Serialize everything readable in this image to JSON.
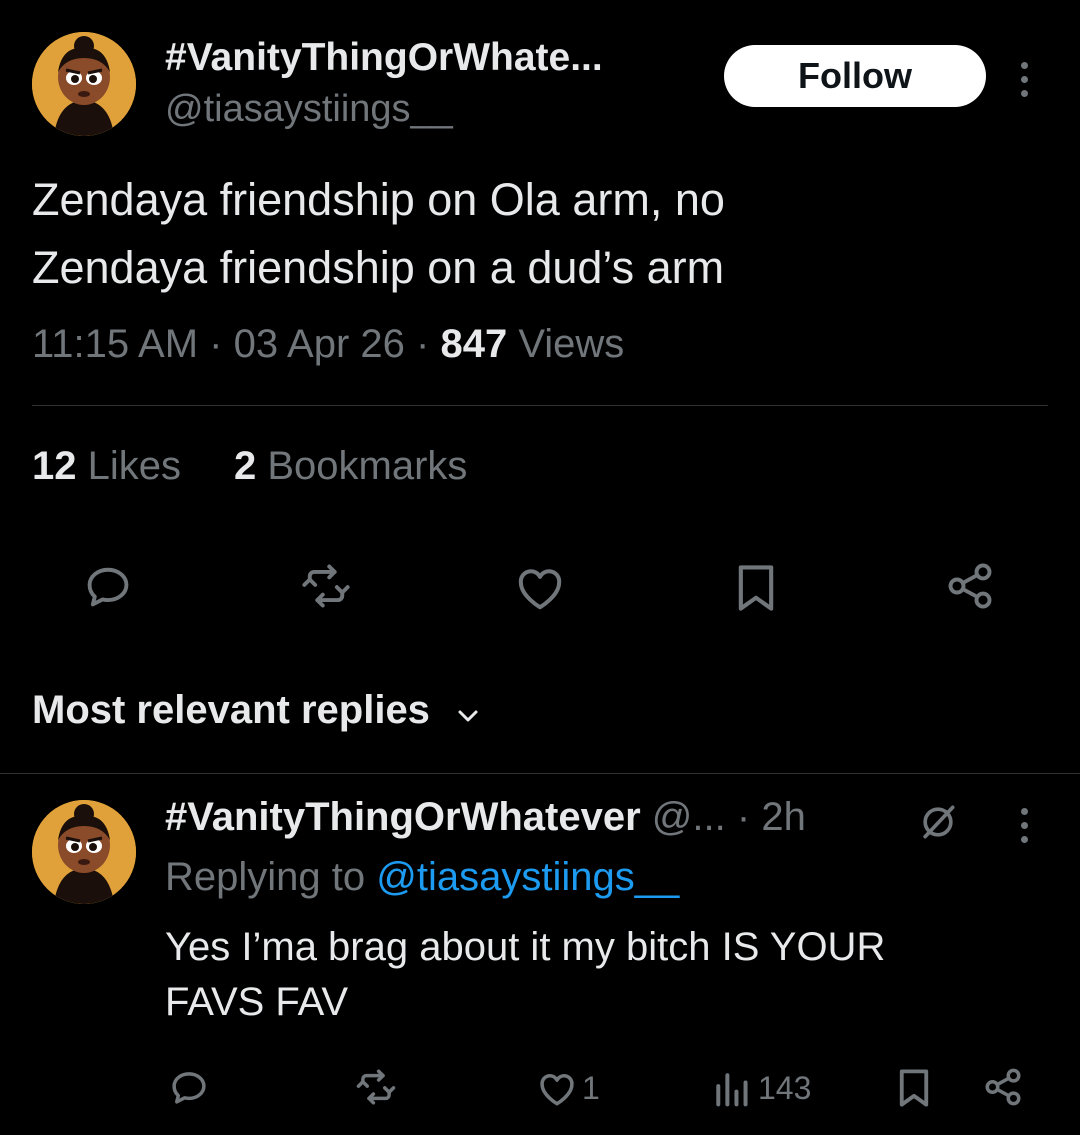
{
  "tweet": {
    "author_name": "#VanityThingOrWhate...",
    "author_handle": "@tiasaystiings__",
    "follow_label": "Follow",
    "text_line1": "Zendaya friendship on Ola arm, no",
    "text_line2": "Zendaya friendship on a dud’s arm",
    "time": "11:15 AM",
    "sep1": "·",
    "date": "03 Apr 26",
    "sep2": "·",
    "views_count": "847",
    "views_label": "Views",
    "likes_count": "12",
    "likes_label": "Likes",
    "bookmarks_count": "2",
    "bookmarks_label": "Bookmarks"
  },
  "action_icons": [
    "reply-icon",
    "retweet-icon",
    "like-icon",
    "bookmark-icon",
    "share-icon"
  ],
  "replies_section": {
    "label": "Most relevant replies"
  },
  "reply": {
    "author_name": "#VanityThingOrWhatever",
    "author_handle": "@...",
    "sep": "·",
    "time": "2h",
    "replying_to_label": "Replying to",
    "replying_to_handle": "@tiasaystiings__",
    "text_line1": "Yes I’ma brag about it my bitch IS YOUR",
    "text_line2": "FAVS FAV",
    "likes": "1",
    "views": "143"
  },
  "colors": {
    "background": "#000000",
    "text": "#e7e9ea",
    "muted": "#71767b",
    "link": "#1d9bf0",
    "avatar_bg": "#e0a13a"
  }
}
